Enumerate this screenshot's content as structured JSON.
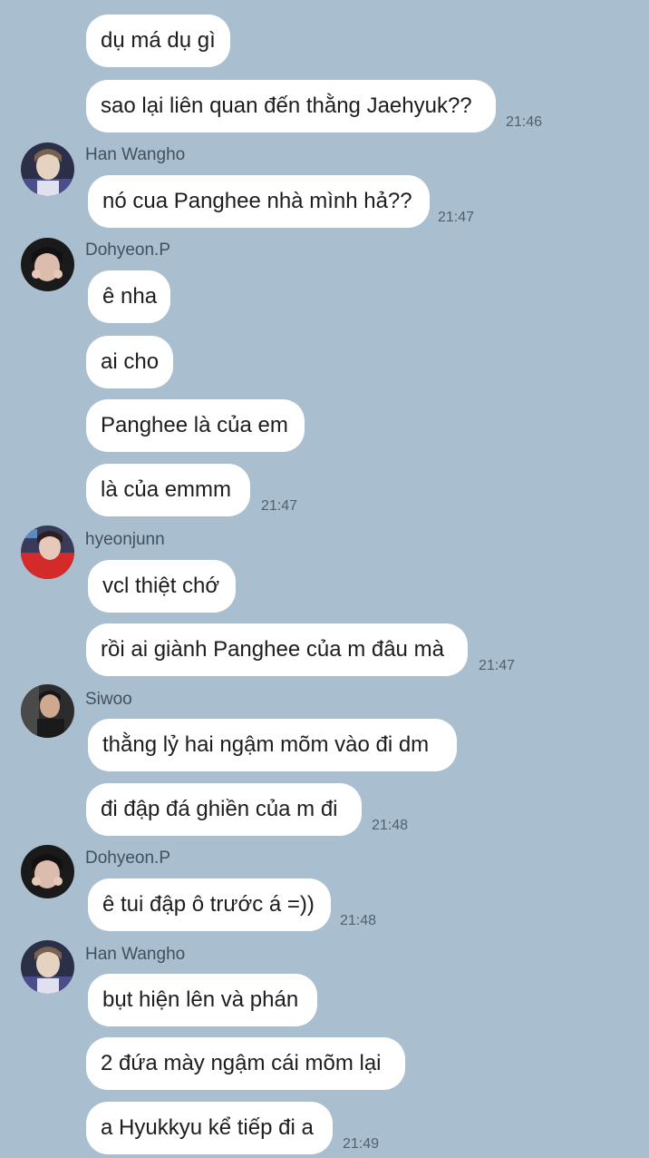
{
  "chat": {
    "messages": [
      {
        "text": "dụ má dụ gì"
      },
      {
        "text": "sao lại liên quan đến thằng Jaehyuk??",
        "time": "21:46"
      },
      {
        "sender": "Han Wangho",
        "text": "nó cua Panghee nhà mình hả??",
        "time": "21:47"
      },
      {
        "sender": "Dohyeon.P",
        "text": "ê nha"
      },
      {
        "text": "ai cho"
      },
      {
        "text": "Panghee là của em"
      },
      {
        "text": "là của emmm",
        "time": "21:47"
      },
      {
        "sender": "hyeonjunn",
        "text": "vcl thiệt chớ"
      },
      {
        "text": "rồi ai giành Panghee của m đâu mà",
        "time": "21:47"
      },
      {
        "sender": "Siwoo",
        "text": "thằng lỷ hai ngậm mõm vào đi dm"
      },
      {
        "text": "đi đập đá ghiền của m đi",
        "time": "21:48"
      },
      {
        "sender": "Dohyeon.P",
        "text": "ê tui đập ô trước á =))",
        "time": "21:48"
      },
      {
        "sender": "Han Wangho",
        "text": "bụt hiện lên và phán"
      },
      {
        "text": "2 đứa mày ngậm cái mõm lại"
      },
      {
        "text": "a Hyukkyu kể tiếp đi a",
        "time": "21:49"
      }
    ],
    "avatars": [
      {
        "name": "hanwangho-avatar",
        "colors": [
          "#2a2f4a",
          "#e8d8c8",
          "#6a6ac0"
        ]
      },
      {
        "name": "dohyeon-avatar",
        "colors": [
          "#1a1a1a",
          "#d8b8a8",
          "#f0f0f0"
        ]
      },
      {
        "name": "hyeonjunn-avatar",
        "colors": [
          "#d82a2a",
          "#e8c8b8",
          "#3a3a5a"
        ]
      },
      {
        "name": "siwoo-avatar",
        "colors": [
          "#2a2a2a",
          "#d0a890",
          "#8a8a8a"
        ]
      }
    ]
  }
}
